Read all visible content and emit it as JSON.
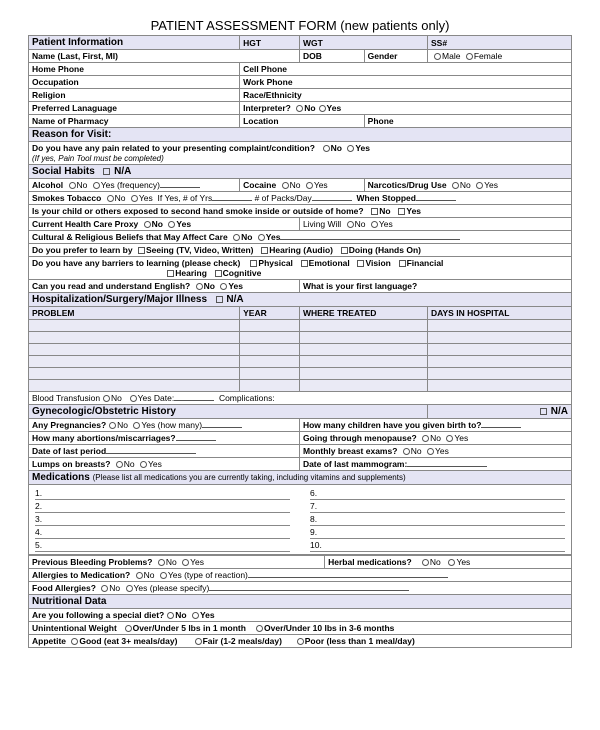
{
  "title": "PATIENT ASSESSMENT FORM (new patients only)",
  "patientInfo": {
    "header": "Patient Information",
    "hgt": "HGT",
    "wgt": "WGT",
    "ss": "SS#",
    "name": "Name (Last, First, MI)",
    "dob": "DOB",
    "gender": "Gender",
    "male": "Male",
    "female": "Female",
    "homePhone": "Home Phone",
    "cellPhone": "Cell Phone",
    "occupation": "Occupation",
    "workPhone": "Work Phone",
    "religion": "Religion",
    "race": "Race/Ethnicity",
    "lang": "Preferred Lanaguage",
    "interp": "Interpreter?",
    "pharmacy": "Name of Pharmacy",
    "location": "Location",
    "phone": "Phone"
  },
  "reason": {
    "header": "Reason for Visit:",
    "q": "Do you have any pain related to your presenting complaint/condition?",
    "note": "(If yes, Pain Tool must be completed)"
  },
  "social": {
    "header": "Social Habits",
    "na": "N/A",
    "alcohol": "Alcohol",
    "freq": "Yes (frequency)",
    "cocaine": "Cocaine",
    "narcotics": "Narcotics/Drug Use",
    "tobacco": "Smokes Tobacco",
    "yrs": "If Yes, # of Yrs",
    "packs": "# of Packs/Day",
    "stopped": "When Stopped",
    "smoke2": "Is your child or others exposed to second hand smoke inside or outside of home?",
    "proxy": "Current Health Care Proxy",
    "living": "Living Will",
    "beliefs": "Cultural & Religious Beliefs that May Affect Care",
    "learn": "Do you prefer to learn by",
    "seeing": "Seeing (TV, Video, Written)",
    "hearing": "Hearing (Audio)",
    "doing": "Doing (Hands On)",
    "barriers": "Do you have any barriers to learning (please check)",
    "phys": "Physical",
    "emo": "Emotional",
    "vis": "Vision",
    "fin": "Financial",
    "hear": "Hearing",
    "cog": "Cognitive",
    "english": "Can you read and understand English?",
    "firstlang": "What is your first language?"
  },
  "hosp": {
    "header": "Hospitalization/Surgery/Major Illness",
    "cols": {
      "problem": "PROBLEM",
      "year": "YEAR",
      "where": "WHERE TREATED",
      "days": "DAYS IN HOSPITAL"
    },
    "blood": "Blood Transfusion",
    "date": "Yes Date:",
    "comp": "Complications:"
  },
  "gyn": {
    "header": "Gynecologic/Obstetric History",
    "na": "N/A",
    "preg": "Any Pregnancies?",
    "howmany": "Yes (how many)",
    "children": "How many children have you given birth to?",
    "abort": "How many abortions/miscarriages?",
    "meno": "Going through menopause?",
    "period": "Date of last period",
    "breast": "Monthly breast exams?",
    "lumps": "Lumps on breasts?",
    "mammo": "Date of last mammogram:"
  },
  "meds": {
    "header": "Medications",
    "note": "(Please list all medications you are currently taking, including vitamins and supplements)",
    "items": [
      "1.",
      "2.",
      "3.",
      "4.",
      "5.",
      "6.",
      "7.",
      "8.",
      "9.",
      "10."
    ],
    "bleeding": "Previous Bleeding Problems?",
    "herbal": "Herbal medications?",
    "allergy": "Allergies to Medication?",
    "react": "Yes (type of reaction)",
    "food": "Food Allergies?",
    "spec": "Yes (please specify)"
  },
  "nutri": {
    "header": "Nutritional Data",
    "diet": "Are you following a special diet?",
    "weight": "Unintentional Weight",
    "w1": "Over/Under 5 lbs in 1 month",
    "w2": "Over/Under 10 lbs in 3-6 months",
    "appetite": "Appetite",
    "a1": "Good (eat 3+ meals/day)",
    "a2": "Fair (1-2 meals/day)",
    "a3": "Poor (less than 1 meal/day)"
  },
  "opts": {
    "no": "No",
    "yes": "Yes"
  }
}
